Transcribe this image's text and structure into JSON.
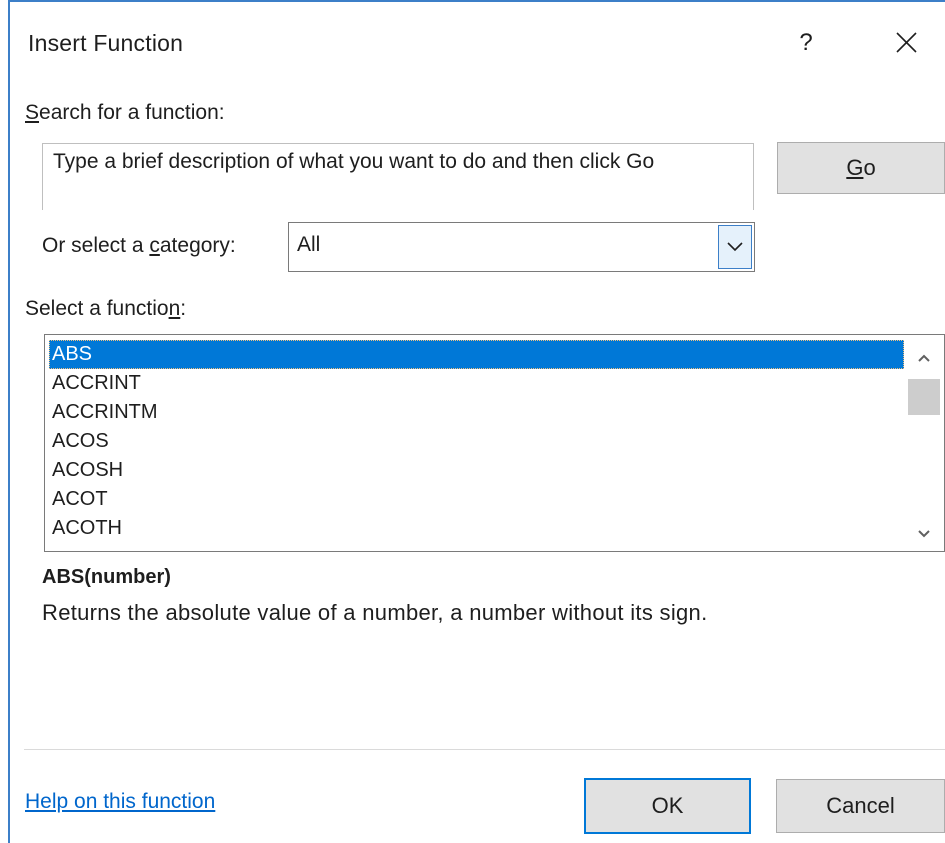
{
  "dialog": {
    "title": "Insert Function",
    "help_glyph": "?",
    "accent_color": "#0078d7"
  },
  "search": {
    "label_prefix": "",
    "label_accel": "S",
    "label_rest": "earch for a function:",
    "value": "Type a brief description of what you want to do and then click Go",
    "go_accel": "G",
    "go_rest": "o"
  },
  "category": {
    "label_prefix": "Or select a ",
    "label_accel": "c",
    "label_rest": "ategory:",
    "selected": "All"
  },
  "function_list": {
    "label_prefix": "Select a functio",
    "label_accel": "n",
    "label_rest": ":",
    "items": [
      "ABS",
      "ACCRINT",
      "ACCRINTM",
      "ACOS",
      "ACOSH",
      "ACOT",
      "ACOTH"
    ],
    "selected_index": 0
  },
  "details": {
    "signature": "ABS(number)",
    "description": "Returns the absolute value of a number, a number without its sign."
  },
  "footer": {
    "help_link": "Help on this function",
    "ok_label": "OK",
    "cancel_label": "Cancel"
  },
  "icons": {
    "help": "question-mark-icon",
    "close": "close-icon",
    "dropdown": "chevron-down-icon",
    "scroll_up": "chevron-up-icon",
    "scroll_down": "chevron-down-icon"
  }
}
